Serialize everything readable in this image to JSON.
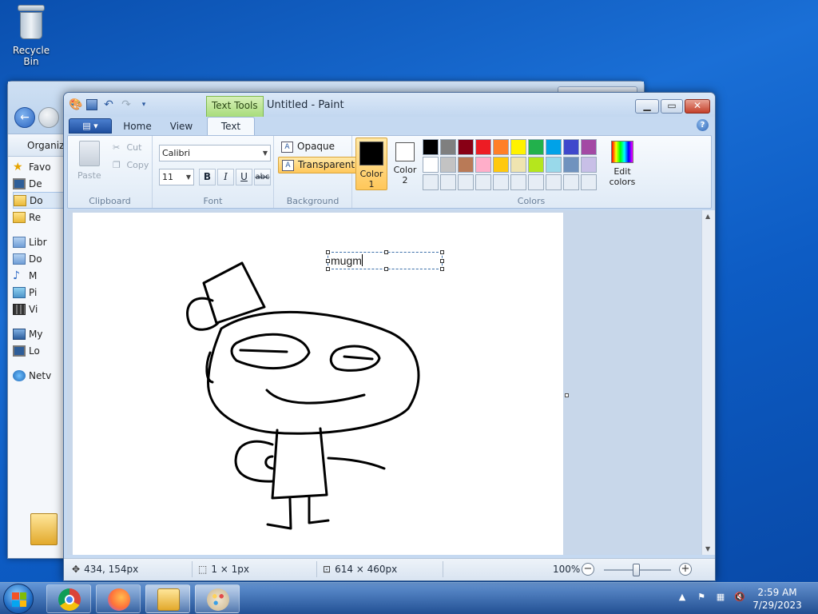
{
  "desktop": {
    "recycle_bin_label": "Recycle Bin"
  },
  "explorer": {
    "toolbar_organize": "Organize",
    "sidebar": [
      {
        "label": "Favo",
        "icon": "star-icon"
      },
      {
        "label": "De",
        "icon": "monitor-icon"
      },
      {
        "label": "Do",
        "icon": "downloads-folder-icon"
      },
      {
        "label": "Re",
        "icon": "recent-places-icon"
      },
      {
        "label": "Libr",
        "icon": "libraries-icon"
      },
      {
        "label": "Do",
        "icon": "documents-icon"
      },
      {
        "label": "M",
        "icon": "music-icon"
      },
      {
        "label": "Pi",
        "icon": "pictures-icon"
      },
      {
        "label": "Vi",
        "icon": "videos-icon"
      },
      {
        "label": "My",
        "icon": "computer-icon"
      },
      {
        "label": "Lo",
        "icon": "local-disk-icon"
      },
      {
        "label": "Netv",
        "icon": "network-icon"
      }
    ]
  },
  "paint": {
    "context_tab": "Text Tools",
    "title": "Untitled - Paint",
    "tabs": {
      "home": "Home",
      "view": "View",
      "text": "Text"
    },
    "clipboard": {
      "paste": "Paste",
      "cut": "Cut",
      "copy": "Copy",
      "group": "Clipboard"
    },
    "font": {
      "name": "Calibri",
      "size": "11",
      "bold": "B",
      "italic": "I",
      "underline": "U",
      "strike": "abc",
      "group": "Font"
    },
    "background": {
      "opaque": "Opaque",
      "transparent": "Transparent",
      "group": "Background",
      "selected": "transparent"
    },
    "colors": {
      "color1_label": "Color",
      "color1_num": "1",
      "color2_label": "Color",
      "color2_num": "2",
      "color1": "#000000",
      "color2": "#ffffff",
      "edit_line1": "Edit",
      "edit_line2": "colors",
      "group": "Colors",
      "palette": [
        "#000000",
        "#7f7f7f",
        "#880015",
        "#ed1c24",
        "#ff7f27",
        "#fff200",
        "#22b14c",
        "#00a2e8",
        "#3f48cc",
        "#a349a4",
        "#ffffff",
        "#c3c3c3",
        "#b97a57",
        "#ffaec9",
        "#ffc90e",
        "#efe4b0",
        "#b5e61d",
        "#99d9ea",
        "#7092be",
        "#c8bfe7",
        "#e6edf5",
        "#e6edf5",
        "#e6edf5",
        "#e6edf5",
        "#e6edf5",
        "#e6edf5",
        "#e6edf5",
        "#e6edf5",
        "#e6edf5",
        "#e6edf5"
      ]
    },
    "canvas": {
      "text_value": "mugm"
    },
    "status": {
      "cursor_pos": "434, 154px",
      "selection_size": "1 × 1px",
      "canvas_size": "614 × 460px",
      "zoom": "100%"
    }
  },
  "taskbar": {
    "time": "2:59 AM",
    "date": "7/29/2023"
  }
}
